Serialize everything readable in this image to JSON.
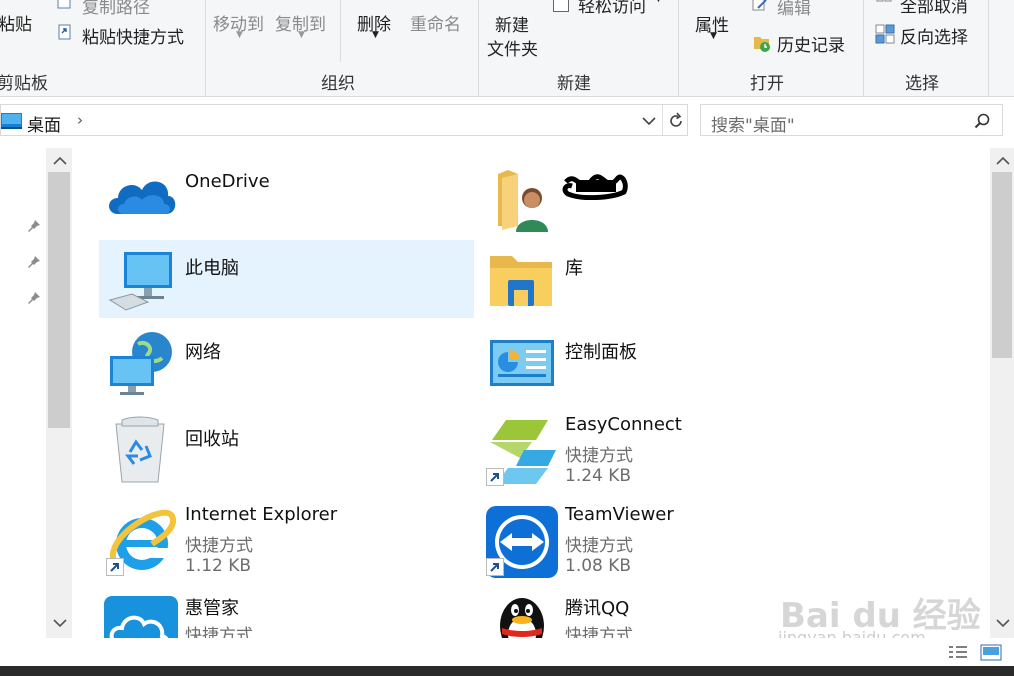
{
  "ribbon": {
    "clipboard": {
      "paste": "粘贴",
      "copy_path": "复制路径",
      "paste_shortcut": "粘贴快捷方式",
      "group": "剪贴板"
    },
    "organize": {
      "move_to": "移动到",
      "copy_to": "复制到",
      "delete": "删除",
      "rename": "重命名",
      "group": "组织"
    },
    "new": {
      "new_folder_line1": "新建",
      "new_folder_line2": "文件夹",
      "easy_access": "轻松访问",
      "group": "新建"
    },
    "open": {
      "properties": "属性",
      "edit": "编辑",
      "history": "历史记录",
      "group": "打开"
    },
    "select": {
      "select_none": "全部取消",
      "invert": "反向选择",
      "group": "选择"
    }
  },
  "address": {
    "location": "桌面",
    "search_placeholder": "搜索\"桌面\""
  },
  "items": [
    {
      "name": "OneDrive",
      "icon": "onedrive-icon"
    },
    {
      "name": "",
      "icon": "user-folder-icon"
    },
    {
      "name": "此电脑",
      "icon": "computer-icon",
      "selected": true
    },
    {
      "name": "库",
      "icon": "library-folder-icon"
    },
    {
      "name": "网络",
      "icon": "network-icon"
    },
    {
      "name": "控制面板",
      "icon": "control-panel-icon"
    },
    {
      "name": "回收站",
      "icon": "recycle-bin-icon"
    },
    {
      "name": "EasyConnect",
      "type": "快捷方式",
      "size": "1.24 KB",
      "icon": "easyconnect-icon"
    },
    {
      "name": "Internet Explorer",
      "type": "快捷方式",
      "size": "1.12 KB",
      "icon": "ie-icon"
    },
    {
      "name": "TeamViewer",
      "type": "快捷方式",
      "size": "1.08 KB",
      "icon": "teamviewer-icon"
    },
    {
      "name": "惠管家",
      "type": "快捷方式",
      "icon": "huiguanjia-icon"
    },
    {
      "name": "腾讯QQ",
      "type": "快捷方式",
      "icon": "qq-icon"
    }
  ],
  "watermark": {
    "brand": "Bai du 经验",
    "url": "jingyan.baidu.com"
  },
  "colors": {
    "selection": "#e5f3ff",
    "accent": "#0078d7"
  }
}
